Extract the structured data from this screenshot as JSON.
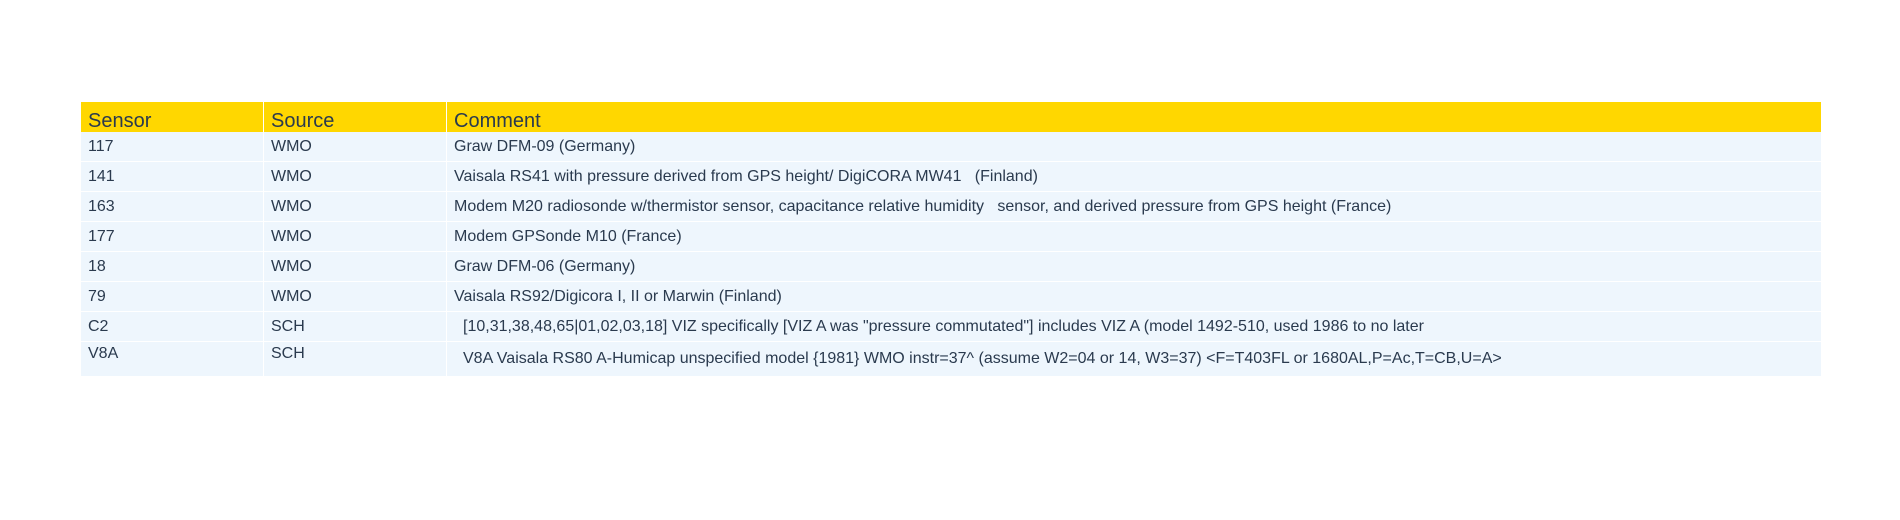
{
  "table": {
    "headers": {
      "sensor": "Sensor",
      "source": "Source",
      "comment": "Comment"
    },
    "rows": [
      {
        "sensor": "117",
        "source": "WMO",
        "comment": "Graw DFM-09 (Germany)"
      },
      {
        "sensor": "141",
        "source": "WMO",
        "comment": "Vaisala RS41 with pressure derived from GPS height/ DigiCORA MW41   (Finland)"
      },
      {
        "sensor": "163",
        "source": "WMO",
        "comment": "Modem M20 radiosonde w/thermistor sensor, capacitance relative humidity   sensor, and derived pressure from GPS height (France)"
      },
      {
        "sensor": "177",
        "source": "WMO",
        "comment": "Modem GPSonde M10 (France)"
      },
      {
        "sensor": "18",
        "source": "WMO",
        "comment": "Graw DFM-06 (Germany)"
      },
      {
        "sensor": "79",
        "source": "WMO",
        "comment": "Vaisala RS92/Digicora I, II or Marwin (Finland)"
      },
      {
        "sensor": "C2",
        "source": "SCH",
        "comment": "[10,31,38,48,65|01,02,03,18] VIZ specifically [VIZ A was \"pressure commutated\"] includes VIZ A (model 1492-510, used 1986 to no later"
      },
      {
        "sensor": "V8A",
        "source": "SCH",
        "comment": "V8A Vaisala RS80 A-Humicap unspecified model {1981} WMO instr=37^ (assume W2=04 or 14, W3=37) <F=T403FL or 1680AL,P=Ac,T=CB,U=A>"
      }
    ]
  },
  "colors": {
    "header_bg": "#ffd700",
    "row_bg": "#eef6fd",
    "text": "#2a3a4e"
  }
}
